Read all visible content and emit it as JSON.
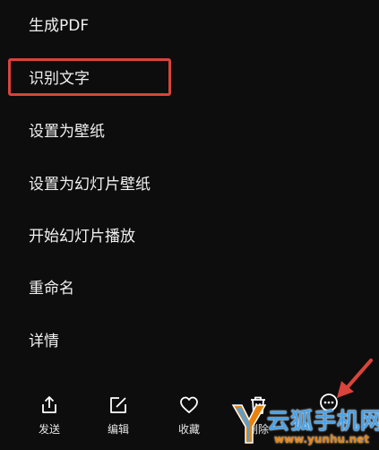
{
  "menu": {
    "items": [
      {
        "label": "生成PDF"
      },
      {
        "label": "识别文字"
      },
      {
        "label": "设置为壁纸"
      },
      {
        "label": "设置为幻灯片壁纸"
      },
      {
        "label": "开始幻灯片播放"
      },
      {
        "label": "重命名"
      },
      {
        "label": "详情"
      }
    ],
    "highlighted_item": "识别文字",
    "highlight_color": "#d9443b"
  },
  "bottom_bar": {
    "actions": [
      {
        "label": "发送",
        "icon": "share-icon"
      },
      {
        "label": "编辑",
        "icon": "edit-icon"
      },
      {
        "label": "收藏",
        "icon": "heart-icon"
      },
      {
        "label": "删除",
        "icon": "trash-icon"
      },
      {
        "label": "更多",
        "icon": "more-icon"
      }
    ]
  },
  "annotation": {
    "icon": "arrow-icon",
    "color": "#d9443b"
  },
  "watermark": {
    "text": "云狐手机网",
    "url": "www.yunhu.net",
    "text_color": "#4aa3e8",
    "url_color": "#e8820c"
  }
}
